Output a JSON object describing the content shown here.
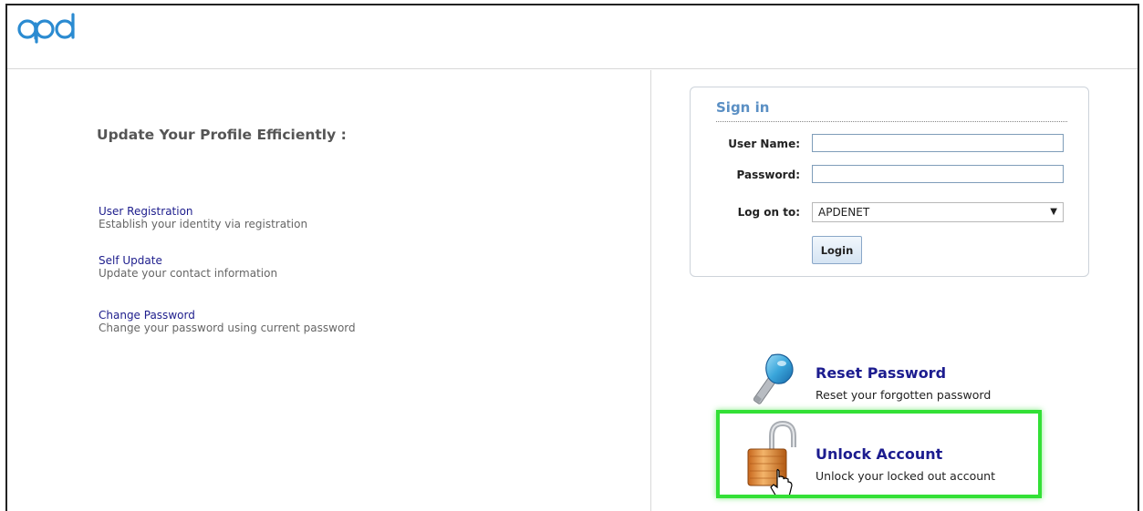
{
  "header": {
    "logo_text": "apd"
  },
  "left": {
    "tagline": "Update Your Profile Efficiently :",
    "links": [
      {
        "label": "User Registration",
        "desc": "Establish your identity via registration"
      },
      {
        "label": "Self Update",
        "desc": "Update your contact information"
      },
      {
        "label": "Change Password",
        "desc": "Change your password using current password"
      }
    ]
  },
  "signin": {
    "title": "Sign in",
    "username_label": "User Name:",
    "username_value": "",
    "password_label": "Password:",
    "password_value": "",
    "logon_label": "Log on to:",
    "logon_selected": "APDENET",
    "login_button": "Login"
  },
  "actions": {
    "reset": {
      "title": "Reset Password",
      "desc": "Reset your forgotten password",
      "icon": "key-icon"
    },
    "unlock": {
      "title": "Unlock Account",
      "desc": "Unlock your locked out account",
      "icon": "padlock-icon"
    }
  },
  "colors": {
    "accent_blue": "#1c1c8f",
    "signin_title": "#5a8fc4",
    "highlight_green": "#33e036"
  }
}
